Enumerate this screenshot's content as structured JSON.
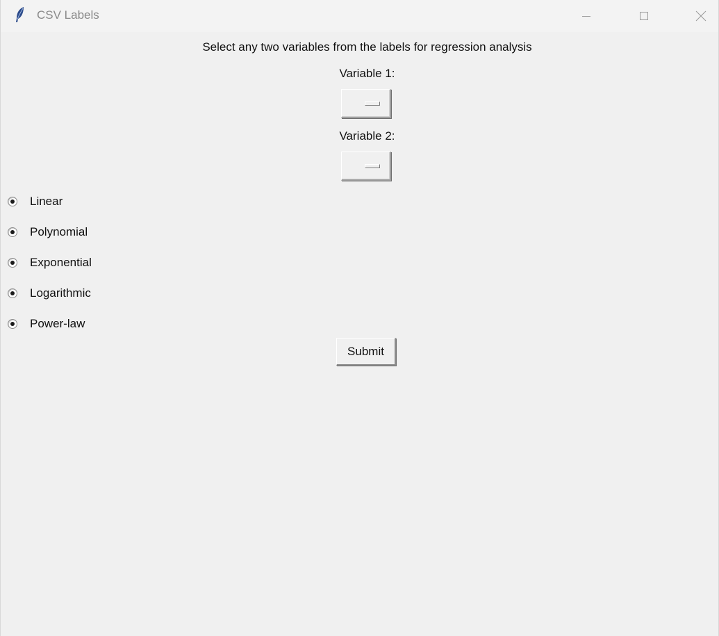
{
  "window": {
    "title": "CSV Labels",
    "icon": "feather-icon"
  },
  "title_bar_controls": {
    "minimize_icon": "minimize-icon",
    "maximize_icon": "maximize-icon",
    "close_icon": "close-icon"
  },
  "main": {
    "instruction": "Select any two variables from the labels for regression analysis",
    "variable1_label": "Variable 1:",
    "variable1_value": "",
    "variable2_label": "Variable 2:",
    "variable2_value": "",
    "regression_options": [
      {
        "label": "Linear"
      },
      {
        "label": "Polynomial"
      },
      {
        "label": "Exponential"
      },
      {
        "label": "Logarithmic"
      },
      {
        "label": "Power-law"
      }
    ],
    "submit_label": "Submit"
  },
  "colors": {
    "window_background": "#f0f0f0",
    "title_text": "#8a8a8a",
    "icon_blue": "#2b4a8a"
  }
}
